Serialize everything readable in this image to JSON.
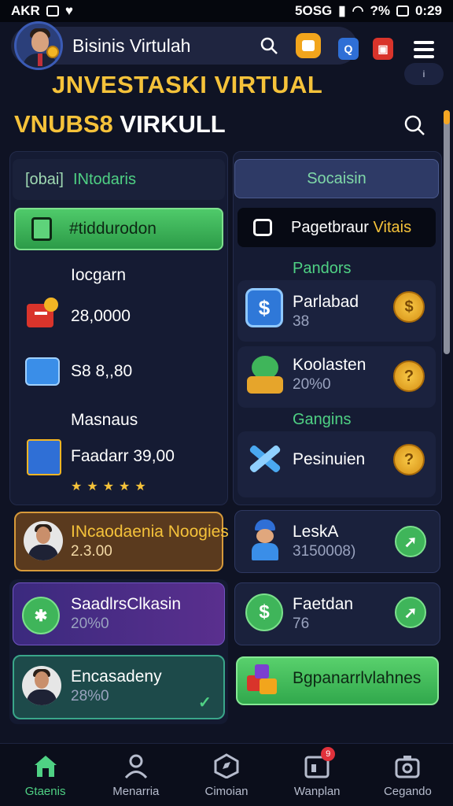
{
  "status_bar": {
    "left_text": "AKR",
    "time_block": "5OSG",
    "battery": "?%",
    "time": "0:29"
  },
  "header": {
    "title": "Bisinis Virtulah",
    "small_pill": "i"
  },
  "headline": {
    "line1": "JNVESTASKI VIRTUAL",
    "line2_yellow": "VNUBS8",
    "line2_white": "VIRKULL"
  },
  "left_panel": {
    "tab_prefix": "[obai]",
    "tab_label": "INtodaris",
    "green_button": "#tiddurodon",
    "items": [
      {
        "label": "Iocgarn"
      },
      {
        "value": "28,0000"
      },
      {
        "value": "S8 8,,80"
      },
      {
        "label": "Masnaus"
      },
      {
        "value": "Faadarr 39,00"
      }
    ],
    "stars": "★★★★★"
  },
  "right_panel": {
    "tab_label": "Socaisin",
    "dark_button_white": "Pagetbraur",
    "dark_button_yellow": "Vitais",
    "section1": "Pandors",
    "section2": "Gangins",
    "rows": [
      {
        "title": "Parlabad",
        "sub": "38",
        "coin": "$"
      },
      {
        "title": "Koolasten",
        "sub": "20%0",
        "coin": "?"
      },
      {
        "title": "Pesinuien",
        "sub": "",
        "coin": "?"
      }
    ]
  },
  "cards": [
    {
      "title": "INcaodaenia Noogies",
      "value": "2.3.00"
    },
    {
      "title": "LeskА",
      "value": "3150008)"
    },
    {
      "title": "SaadlrsClkasin",
      "value": "20%0"
    },
    {
      "title": "Faetdan",
      "value": "76"
    },
    {
      "title": "Encasadeny",
      "value": "28%0"
    },
    {
      "title": "Bgpanarrlvlahnes",
      "value": ""
    }
  ],
  "bottom_nav": [
    {
      "label": "Gtaenis",
      "active": true
    },
    {
      "label": "Menarria",
      "active": false
    },
    {
      "label": "Cimoian",
      "active": false
    },
    {
      "label": "Wanplan",
      "active": false,
      "badge": "9"
    },
    {
      "label": "Cegando",
      "active": false
    }
  ],
  "colors": {
    "background": "#0f1324",
    "accent_green": "#4fd184",
    "accent_yellow": "#f5c23a"
  }
}
